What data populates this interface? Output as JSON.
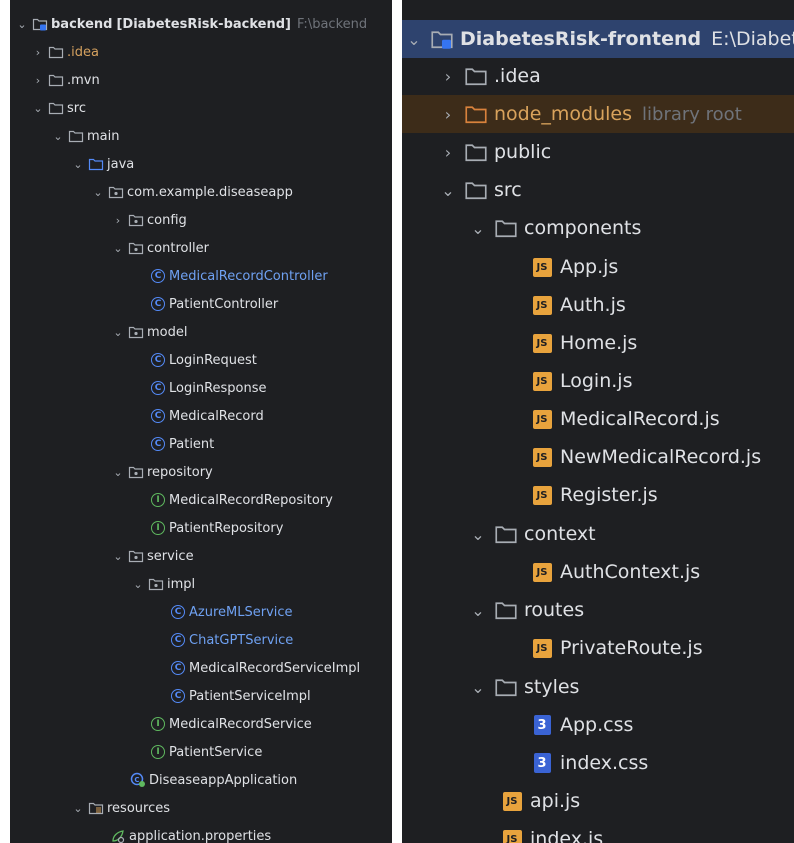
{
  "backend": {
    "root": {
      "name": "backend",
      "module": "[DiabetesRisk-backend]",
      "path": "F:\\backend"
    },
    "items": [
      {
        "label": ".idea"
      },
      {
        "label": ".mvn"
      },
      {
        "label": "src"
      },
      {
        "label": "main"
      },
      {
        "label": "java"
      },
      {
        "label": "com.example.diseaseapp"
      },
      {
        "label": "config"
      },
      {
        "label": "controller"
      },
      {
        "label": "MedicalRecordController"
      },
      {
        "label": "PatientController"
      },
      {
        "label": "model"
      },
      {
        "label": "LoginRequest"
      },
      {
        "label": "LoginResponse"
      },
      {
        "label": "MedicalRecord"
      },
      {
        "label": "Patient"
      },
      {
        "label": "repository"
      },
      {
        "label": "MedicalRecordRepository"
      },
      {
        "label": "PatientRepository"
      },
      {
        "label": "service"
      },
      {
        "label": "impl"
      },
      {
        "label": "AzureMLService"
      },
      {
        "label": "ChatGPTService"
      },
      {
        "label": "MedicalRecordServiceImpl"
      },
      {
        "label": "PatientServiceImpl"
      },
      {
        "label": "MedicalRecordService"
      },
      {
        "label": "PatientService"
      },
      {
        "label": "DiseaseappApplication"
      },
      {
        "label": "resources"
      },
      {
        "label": "application.properties"
      }
    ]
  },
  "frontend": {
    "root": {
      "name": "DiabetesRisk-frontend",
      "path": "E:\\Diabet"
    },
    "items": [
      {
        "label": ".idea"
      },
      {
        "label": "node_modules",
        "hint": "library root"
      },
      {
        "label": "public"
      },
      {
        "label": "src"
      },
      {
        "label": "components"
      },
      {
        "label": "App.js"
      },
      {
        "label": "Auth.js"
      },
      {
        "label": "Home.js"
      },
      {
        "label": "Login.js"
      },
      {
        "label": "MedicalRecord.js"
      },
      {
        "label": "NewMedicalRecord.js"
      },
      {
        "label": "Register.js"
      },
      {
        "label": "context"
      },
      {
        "label": "AuthContext.js"
      },
      {
        "label": "routes"
      },
      {
        "label": "PrivateRoute.js"
      },
      {
        "label": "styles"
      },
      {
        "label": "App.css"
      },
      {
        "label": "index.css"
      },
      {
        "label": "api.js"
      },
      {
        "label": "index.js"
      }
    ]
  },
  "badges": {
    "js": "JS",
    "css": "3",
    "class": "C",
    "interface": "I"
  },
  "chevrons": {
    "expanded": "⌄",
    "collapsed": "›"
  },
  "colors": {
    "background": "#1e1f22",
    "text": "#dfe1e5",
    "selection": "#2e436e",
    "excluded": "#3d2c19",
    "class_icon": "#548af7",
    "interface_icon": "#5fb85f",
    "modified_file": "#6fa1f2",
    "ignored_file": "#d5a15f"
  }
}
